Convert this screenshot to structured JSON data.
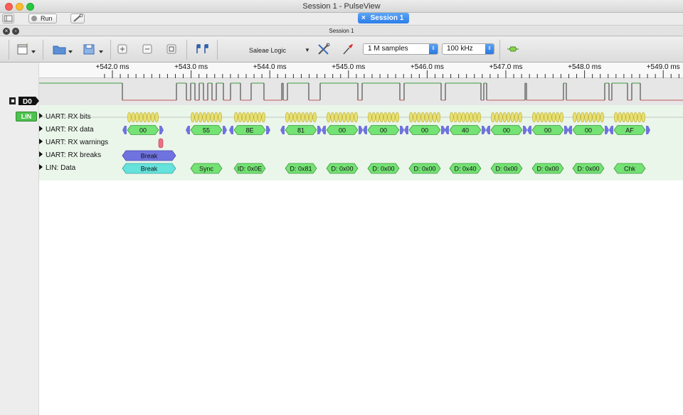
{
  "window": {
    "title": "Session 1 - PulseView"
  },
  "toolbar1": {
    "run_label": "Run"
  },
  "session_tab": {
    "label": "Session 1",
    "close_glyph": "×"
  },
  "tab_header": {
    "title": "Session 1"
  },
  "main_toolbar": {
    "driver": "Saleae Logic",
    "samples": "1 M samples",
    "samplerate": "100 kHz",
    "icons": [
      "new-session-icon",
      "open-icon",
      "save-icon",
      "zoom-in-icon",
      "zoom-out-icon",
      "zoom-fit-icon",
      "cursor-icon",
      "configure-device-icon",
      "probe-icon",
      "decoder-add-icon"
    ]
  },
  "ruler": {
    "ticks": [
      "+542.0 ms",
      "+543.0 ms",
      "+544.0 ms",
      "+545.0 ms",
      "+546.0 ms",
      "+547.0 ms",
      "+548.0 ms",
      "+549.0 ms"
    ]
  },
  "channels": {
    "d0": {
      "name": "D0"
    },
    "lin": {
      "name": "LIN"
    }
  },
  "rows": [
    {
      "label": "UART: RX bits"
    },
    {
      "label": "UART: RX data"
    },
    {
      "label": "UART: RX warnings"
    },
    {
      "label": "UART: RX breaks"
    },
    {
      "label": "LIN: Data"
    }
  ],
  "rx_data": [
    "00",
    "55",
    "8E",
    "81",
    "00",
    "00",
    "00",
    "40",
    "00",
    "00",
    "00",
    "AF"
  ],
  "rx_breaks": [
    "Break"
  ],
  "lin_data": [
    "Break",
    "Sync",
    "ID: 0x0E",
    "D: 0x81",
    "D: 0x00",
    "D: 0x00",
    "D: 0x00",
    "D: 0x40",
    "D: 0x00",
    "D: 0x00",
    "D: 0x00",
    "Chk"
  ],
  "colors": {
    "bits": "#e8e070",
    "data": "#74e274",
    "break": "#6f73df",
    "lin_break": "#66e2dc",
    "warning": "#ee6f7f",
    "signal_low": "#c25a5a",
    "signal_high": "#3f9a3f"
  }
}
